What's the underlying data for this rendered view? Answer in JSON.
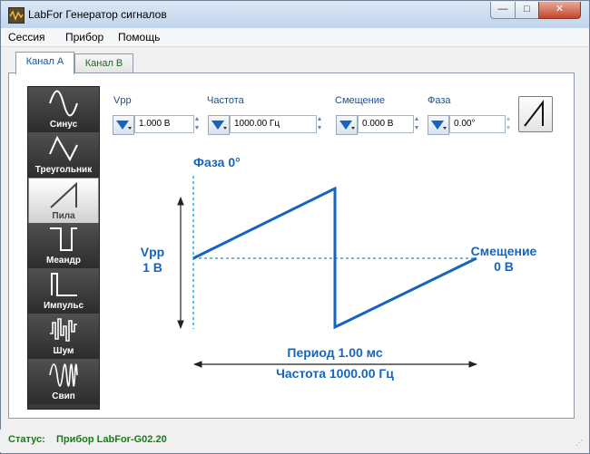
{
  "window": {
    "title": "LabFor Генератор сигналов",
    "minimize_glyph": "—",
    "maximize_glyph": "□",
    "close_glyph": "✕"
  },
  "menu": [
    "Сессия",
    "Прибор",
    "Помощь"
  ],
  "tabs": [
    {
      "label": "Канал A",
      "active": true
    },
    {
      "label": "Канал B",
      "active": false
    }
  ],
  "waveforms": [
    {
      "label": "Синус",
      "icon": "sine-wave-icon"
    },
    {
      "label": "Треугольник",
      "icon": "triangle-wave-icon"
    },
    {
      "label": "Пила",
      "icon": "sawtooth-wave-icon",
      "selected": true
    },
    {
      "label": "Меандр",
      "icon": "square-wave-icon"
    },
    {
      "label": "Импульс",
      "icon": "pulse-wave-icon"
    },
    {
      "label": "Шум",
      "icon": "noise-wave-icon"
    },
    {
      "label": "Свип",
      "icon": "sweep-wave-icon"
    }
  ],
  "params": {
    "vpp": {
      "label": "Vpp",
      "value": "1.000 В"
    },
    "freq": {
      "label": "Частота",
      "value": "1000.00 Гц"
    },
    "offset": {
      "label": "Смещение",
      "value": "0.000 В"
    },
    "phase": {
      "label": "Фаза",
      "value": "0.00°"
    }
  },
  "diagram": {
    "phase": "Фаза 0°",
    "vpp_label": "Vpp",
    "vpp_value": "1 В",
    "offset_label": "Смещение",
    "offset_value": "0 В",
    "period": "Период 1.00 мс",
    "frequency": "Частота 1000.00 Гц"
  },
  "status": {
    "label": "Статус:",
    "value": "Прибор LabFor-G02.20"
  },
  "colors": {
    "accent": "#1565c0",
    "dashed": "#29a8d8",
    "status": "#1a7a1a"
  }
}
